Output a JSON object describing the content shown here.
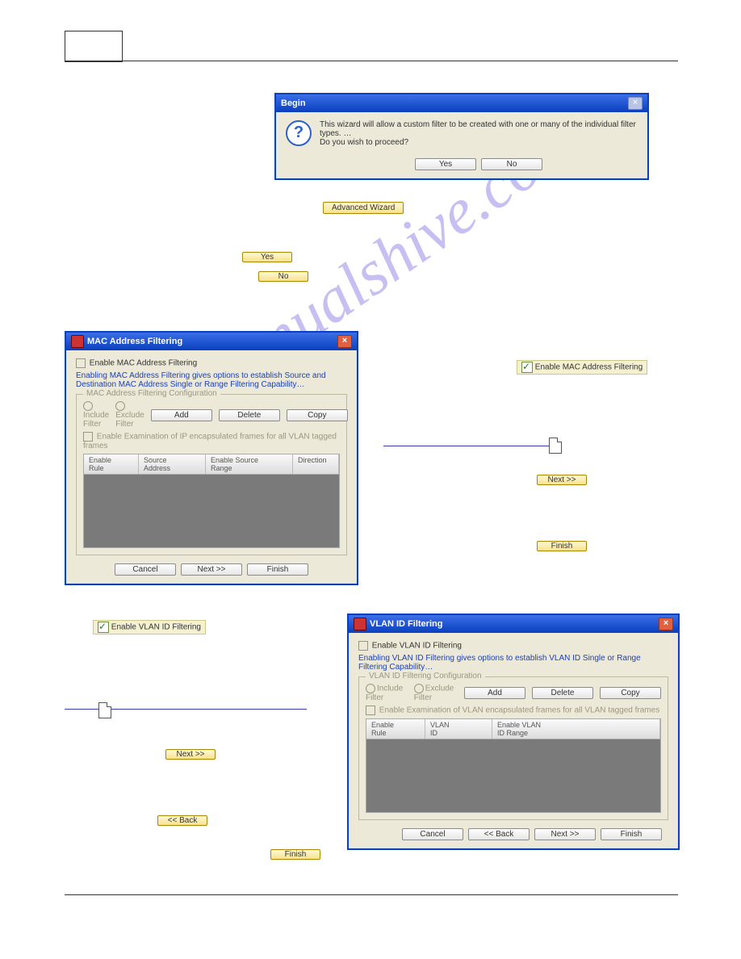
{
  "watermark": "manualshive.com",
  "begin_dialog": {
    "title": "Begin",
    "line1": "This wizard will allow a custom filter to be created with one or many of the individual filter types.  …",
    "line2": "Do you wish to proceed?",
    "yes": "Yes",
    "no": "No"
  },
  "buttons": {
    "advanced_wizard": "Advanced Wizard",
    "yes": "Yes",
    "no": "No",
    "next": "Next >>",
    "back": "<< Back",
    "finish": "Finish",
    "cancel": "Cancel",
    "add": "Add",
    "delete": "Delete",
    "copy": "Copy"
  },
  "mac_dialog": {
    "title": "MAC Address Filtering",
    "enable": "Enable MAC Address Filtering",
    "hint": "Enabling MAC Address Filtering gives options to establish Source and Destination MAC Address Single or Range Filtering Capability…",
    "group": "MAC Address Filtering Configuration",
    "include": "Include Filter",
    "exclude": "Exclude Filter",
    "exam": "Enable Examination of IP encapsulated frames for all VLAN tagged frames",
    "cols": {
      "c1": "Enable\nRule",
      "c2": "Source\nAddress",
      "c3": "Enable Source\nRange",
      "c4": "Direction"
    }
  },
  "mac_enable_chip": "Enable MAC Address Filtering",
  "vlan_enable_chip": "Enable VLAN ID Filtering",
  "vlan_dialog": {
    "title": "VLAN ID Filtering",
    "enable": "Enable VLAN ID Filtering",
    "hint": "Enabling VLAN ID Filtering gives options to establish VLAN ID Single or Range Filtering Capability…",
    "group": "VLAN ID Filtering Configuration",
    "include": "Include Filter",
    "exclude": "Exclude Filter",
    "exam": "Enable Examination of VLAN encapsulated frames for all VLAN tagged frames",
    "cols": {
      "c1": "Enable\nRule",
      "c2": "VLAN\nID",
      "c3": "Enable VLAN\nID Range"
    }
  }
}
